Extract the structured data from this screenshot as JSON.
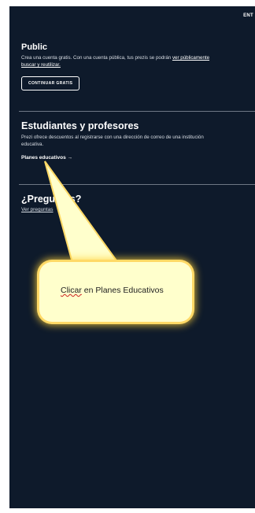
{
  "header": {
    "enter_label": "ENT"
  },
  "public": {
    "title": "Public",
    "desc_line1": "Crea una cuenta gratis. Con una cuenta pública, tus prezis se podrán ",
    "desc_link1": "ver públicamente",
    "desc_link2": "buscar y reutilizar.",
    "button_label": "CONTINUAR GRATIS"
  },
  "education": {
    "title": "Estudiantes y profesores",
    "desc_line1": "Prezi ofrece descuentos al registrarse con una dirección de correo de una institución",
    "desc_line2": "educativa.",
    "link_label": "Planes educativos →"
  },
  "faq": {
    "title": "¿Preguntas?",
    "link_label": "Ver preguntas"
  },
  "annotation": {
    "text_word1": "Clicar",
    "text_rest": " en Planes Educativos"
  },
  "colors": {
    "panel_bg": "#0e1a2b",
    "callout_bg": "#ffffcc",
    "callout_glow": "#ffd966"
  }
}
